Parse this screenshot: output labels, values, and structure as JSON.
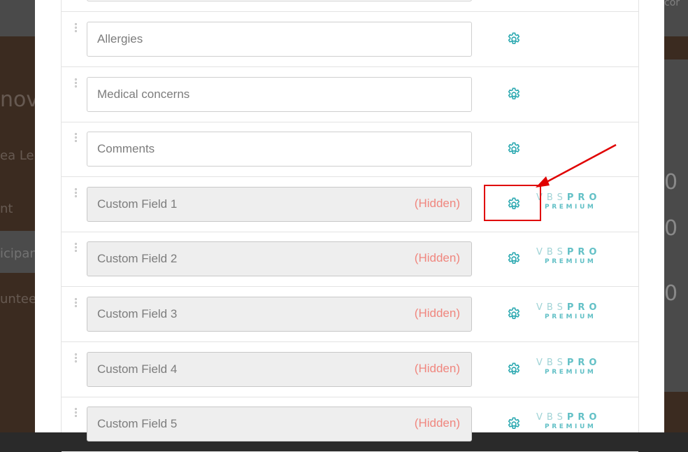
{
  "background": {
    "left_texts": [
      "nov",
      "ea Le",
      "nt",
      "icipan",
      "unteer"
    ],
    "right_values": [
      "0",
      "0",
      "0"
    ],
    "top_right_text": "cor"
  },
  "fields": [
    {
      "label": "Allergies",
      "hidden": "",
      "premium": false
    },
    {
      "label": "Medical concerns",
      "hidden": "",
      "premium": false
    },
    {
      "label": "Comments",
      "hidden": "",
      "premium": false
    },
    {
      "label": "Custom Field 1",
      "hidden": "(Hidden)",
      "premium": true
    },
    {
      "label": "Custom Field 2",
      "hidden": "(Hidden)",
      "premium": true
    },
    {
      "label": "Custom Field 3",
      "hidden": "(Hidden)",
      "premium": true
    },
    {
      "label": "Custom Field 4",
      "hidden": "(Hidden)",
      "premium": true
    },
    {
      "label": "Custom Field 5",
      "hidden": "(Hidden)",
      "premium": true
    }
  ],
  "badge": {
    "vbs": "VBS",
    "pro": "PRO",
    "premium": "PREMIUM"
  },
  "colors": {
    "accent": "#2aa8b0",
    "hidden_text": "#f0867e",
    "annotation": "#e00000"
  },
  "icons": {
    "settings": "gear-icon",
    "drag": "drag-handle-icon"
  }
}
